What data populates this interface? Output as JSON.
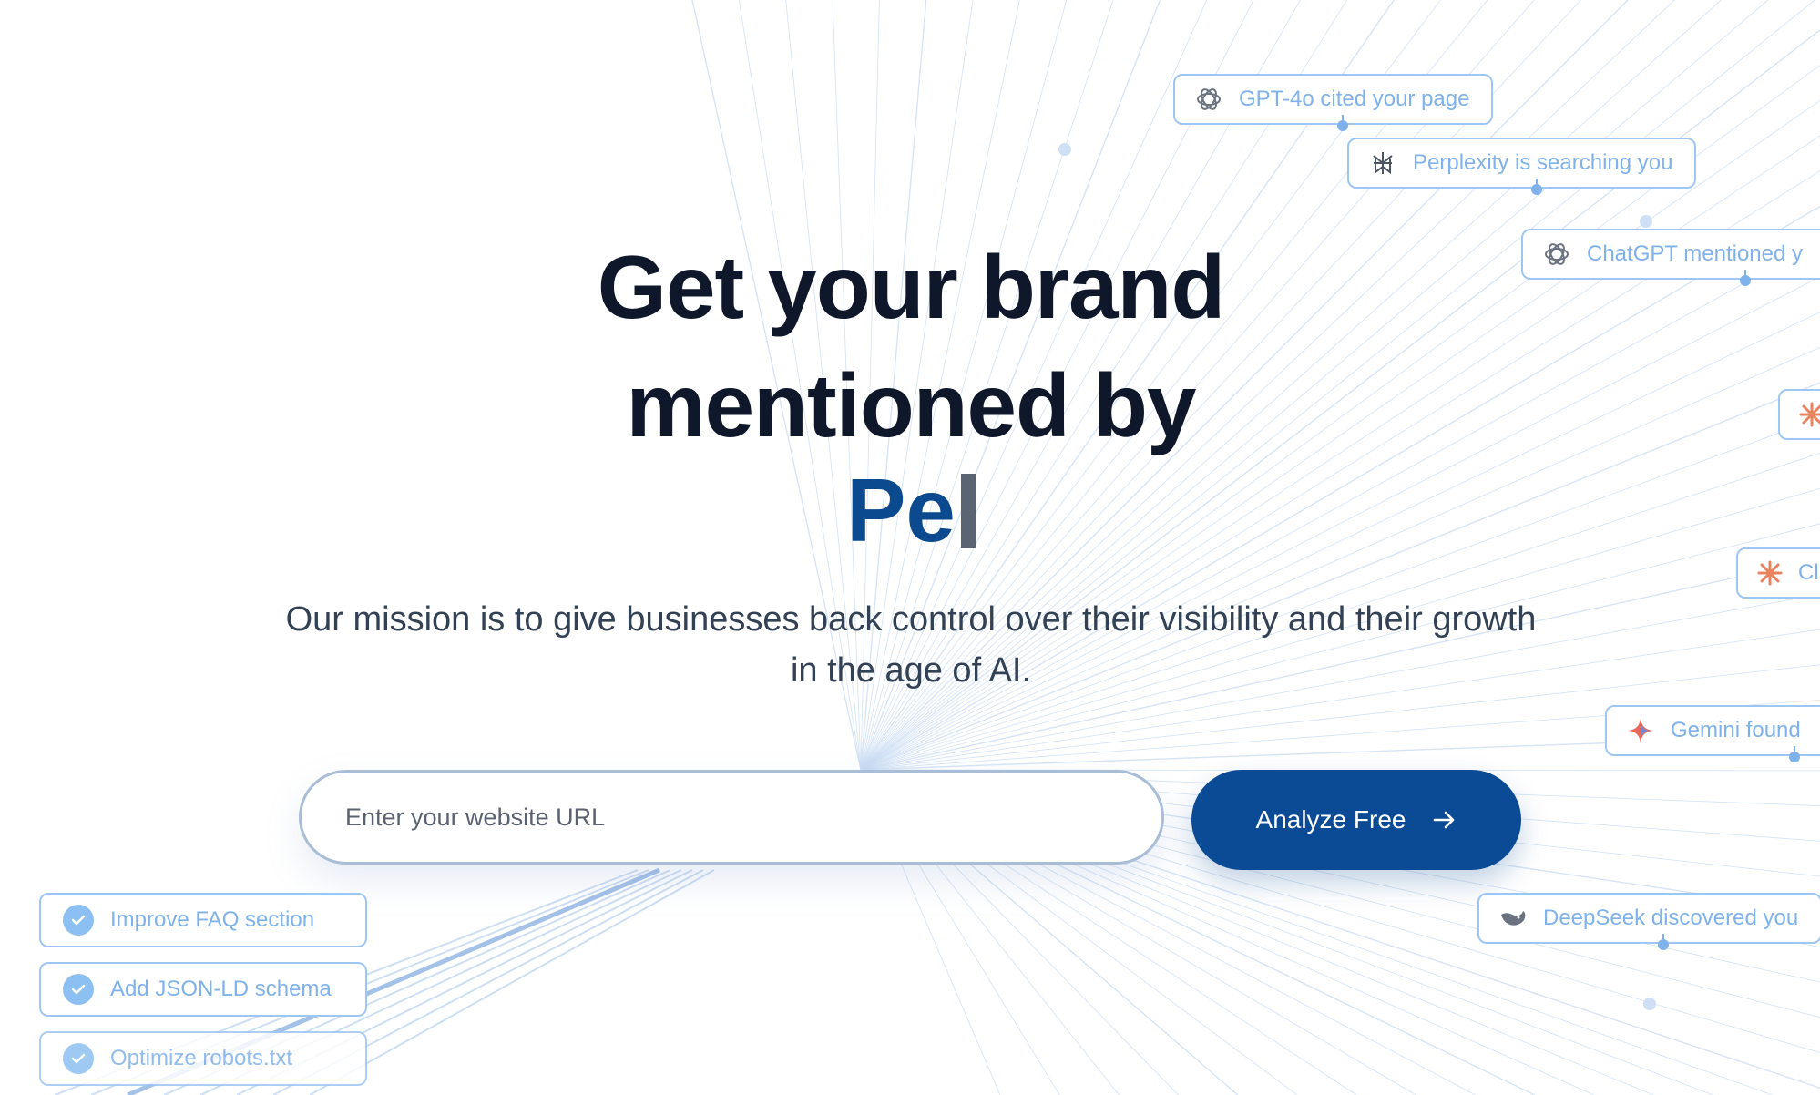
{
  "hero": {
    "headline_line1": "Get your brand",
    "headline_line2": "mentioned by",
    "typed_text": "Pe",
    "mission": "Our mission is to give businesses back control over their visibility and their growth in the age of AI."
  },
  "search": {
    "placeholder": "Enter your website URL",
    "button_label": "Analyze Free"
  },
  "notifications": [
    {
      "icon": "openai-icon",
      "text": "GPT-4o cited your page"
    },
    {
      "icon": "perplexity-icon",
      "text": "Perplexity is searching you"
    },
    {
      "icon": "openai-icon",
      "text": "ChatGPT mentioned y"
    },
    {
      "icon": "claude-icon",
      "text": ""
    },
    {
      "icon": "claude-icon",
      "text": "Cl"
    },
    {
      "icon": "gemini-icon",
      "text": "Gemini found"
    },
    {
      "icon": "deepseek-icon",
      "text": "DeepSeek discovered you"
    }
  ],
  "tasks": [
    {
      "icon": "check-icon",
      "text": "Improve FAQ section"
    },
    {
      "icon": "check-icon",
      "text": "Add JSON-LD schema"
    },
    {
      "icon": "check-icon",
      "text": "Optimize robots.txt"
    }
  ],
  "colors": {
    "primary": "#0b4a94",
    "heading": "#0f172a",
    "badge_border": "#9ec6f3",
    "badge_text": "#7fb2ea",
    "claude": "#e8825f"
  }
}
